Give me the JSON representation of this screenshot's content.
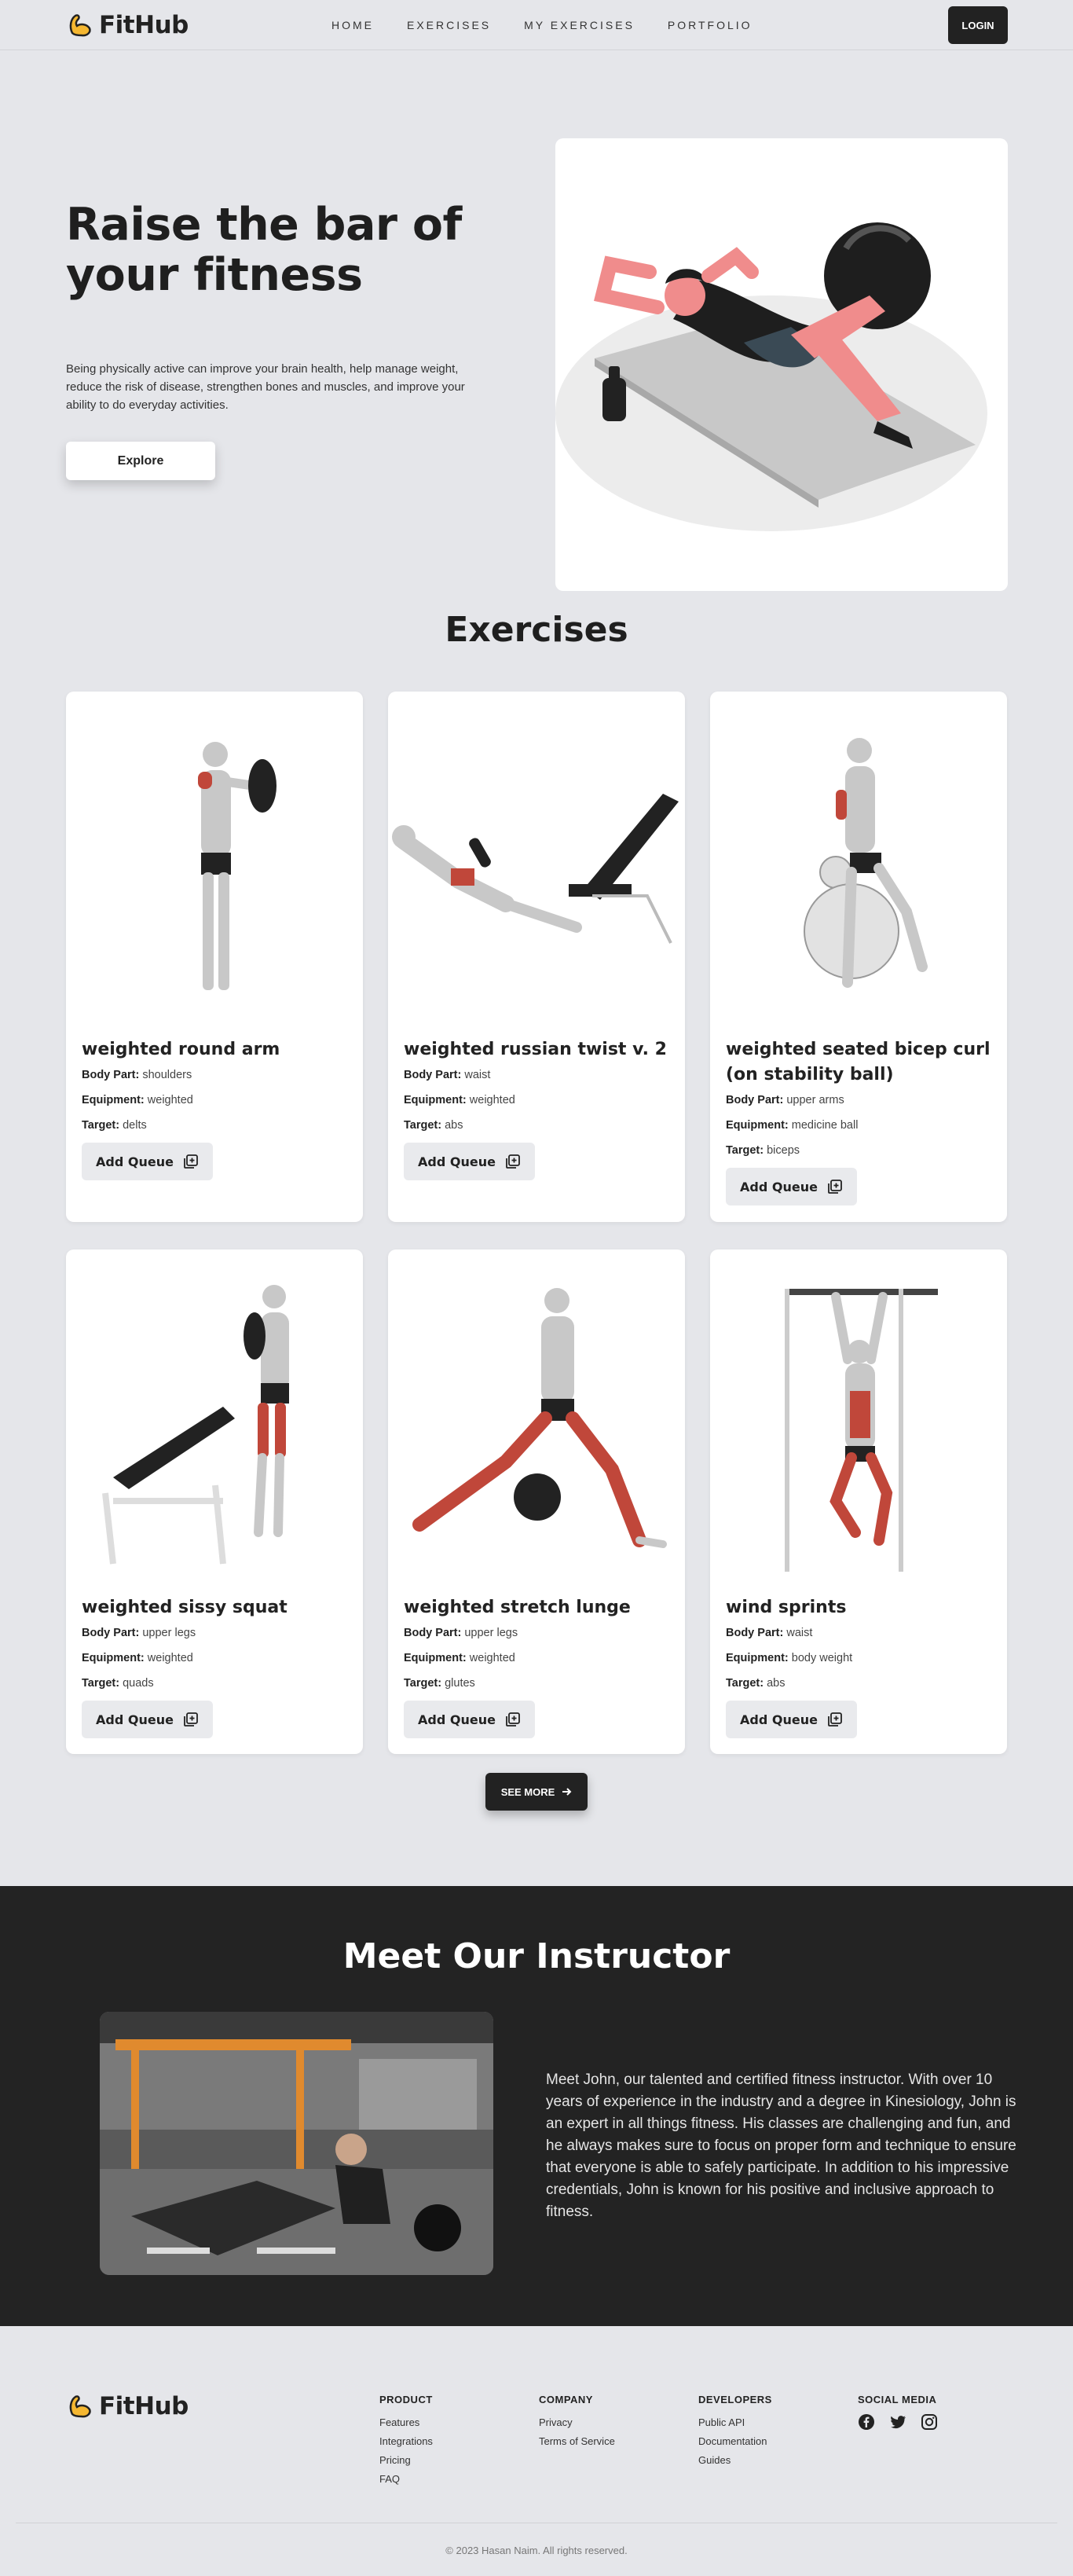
{
  "brand": {
    "name": "FitHub",
    "accent": "#f5b731"
  },
  "nav": {
    "items": [
      "HOME",
      "EXERCISES",
      "MY EXERCISES",
      "PORTFOLIO"
    ],
    "login": "LOGIN"
  },
  "hero": {
    "title": "Raise the bar of your fitness",
    "description": "Being physically active can improve your brain health, help manage weight, reduce the risk of disease, strengthen bones and muscles, and improve your ability to do everyday activities.",
    "button": "Explore"
  },
  "exercises": {
    "title": "Exercises",
    "labels": {
      "body_part": "Body Part:",
      "equipment": "Equipment:",
      "target": "Target:",
      "add": "Add Queue"
    },
    "items": [
      {
        "name": "weighted round arm",
        "body_part": "shoulders",
        "equipment": "weighted",
        "target": "delts"
      },
      {
        "name": "weighted russian twist v. 2",
        "body_part": "waist",
        "equipment": "weighted",
        "target": "abs"
      },
      {
        "name": "weighted seated bicep curl (on stability ball)",
        "body_part": "upper arms",
        "equipment": "medicine ball",
        "target": "biceps"
      },
      {
        "name": "weighted sissy squat",
        "body_part": "upper legs",
        "equipment": "weighted",
        "target": "quads"
      },
      {
        "name": "weighted stretch lunge",
        "body_part": "upper legs",
        "equipment": "weighted",
        "target": "glutes"
      },
      {
        "name": "wind sprints",
        "body_part": "waist",
        "equipment": "body weight",
        "target": "abs"
      }
    ],
    "see_more": "SEE MORE"
  },
  "instructor": {
    "title": "Meet Our Instructor",
    "bio": "Meet John, our talented and certified fitness instructor. With over 10 years of experience in the industry and a degree in Kinesiology, John is an expert in all things fitness. His classes are challenging and fun, and he always makes sure to focus on proper form and technique to ensure that everyone is able to safely participate. In addition to his impressive credentials, John is known for his positive and inclusive approach to fitness."
  },
  "footer": {
    "product": {
      "title": "PRODUCT",
      "links": [
        "Features",
        "Integrations",
        "Pricing",
        "FAQ"
      ]
    },
    "company": {
      "title": "COMPANY",
      "links": [
        "Privacy",
        "Terms of Service"
      ]
    },
    "developers": {
      "title": "DEVELOPERS",
      "links": [
        "Public API",
        "Documentation",
        "Guides"
      ]
    },
    "social": {
      "title": "SOCIAL MEDIA",
      "icons": [
        "facebook-icon",
        "twitter-icon",
        "instagram-icon"
      ]
    },
    "copyright": "© 2023 Hasan Naim. All rights reserved."
  }
}
